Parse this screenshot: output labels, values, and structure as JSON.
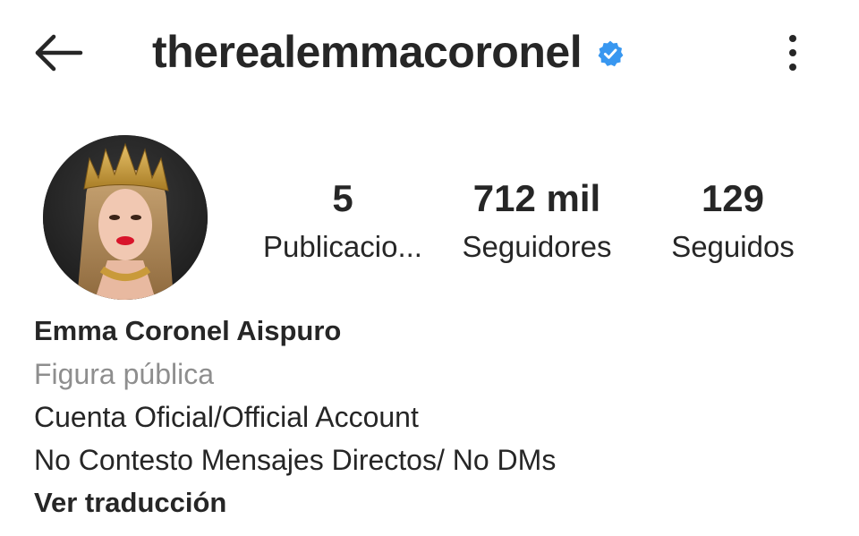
{
  "header": {
    "username": "therealemmacoronel",
    "back_icon": "arrow-left-icon",
    "verified_icon": "verified-badge-icon",
    "more_icon": "vertical-dots-icon",
    "verified_color": "#3897f0"
  },
  "profile": {
    "avatar_icon": "profile-photo",
    "stats": {
      "posts": {
        "value": "5",
        "label": "Publicacio..."
      },
      "followers": {
        "value": "712 mil",
        "label": "Seguidores"
      },
      "following": {
        "value": "129",
        "label": "Seguidos"
      }
    }
  },
  "bio": {
    "full_name": "Emma Coronel Aispuro",
    "category": "Figura pública",
    "lines": [
      "Cuenta Oficial/Official Account",
      "No Contesto Mensajes Directos/ No DMs"
    ],
    "translate_link": "Ver traducción"
  },
  "colors": {
    "text": "#262626",
    "secondary_text": "#8e8e8e",
    "background": "#ffffff"
  }
}
